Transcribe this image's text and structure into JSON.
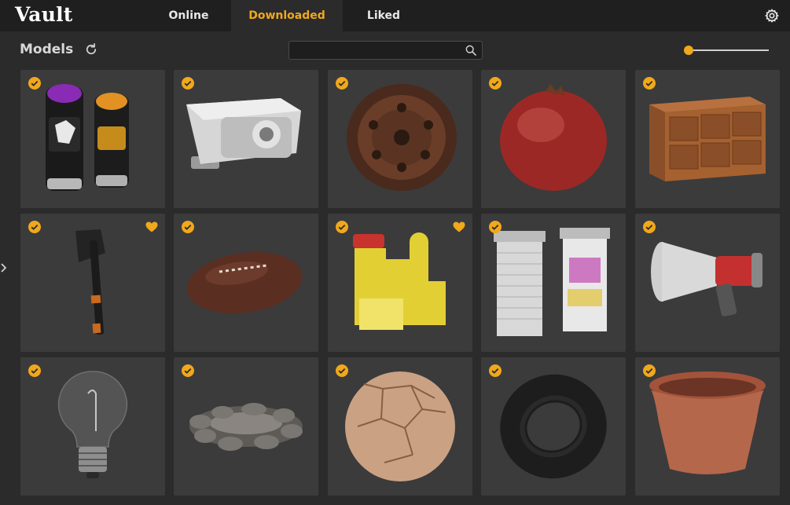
{
  "app": {
    "title": "Vault"
  },
  "tabs": [
    {
      "label": "Online",
      "active": false
    },
    {
      "label": "Downloaded",
      "active": true
    },
    {
      "label": "Liked",
      "active": false
    }
  ],
  "toolbar": {
    "section_title": "Models",
    "search_value": "",
    "search_placeholder": "",
    "size_slider_level": 0.0
  },
  "colors": {
    "accent": "#f0a81c",
    "background": "#2b2b2b",
    "topbar": "#1f1f1f",
    "card": "#3b3b3b"
  },
  "icons": {
    "settings": "gear-icon",
    "refresh": "refresh-icon",
    "search": "search-icon",
    "downloaded_badge": "check-circle-icon",
    "liked_badge": "heart-icon",
    "collapse": "chevron-right-icon"
  },
  "models": [
    {
      "subject": "spray-cans",
      "downloaded": true,
      "liked": false
    },
    {
      "subject": "security-camera",
      "downloaded": true,
      "liked": false
    },
    {
      "subject": "steel-wheel-rim",
      "downloaded": true,
      "liked": false
    },
    {
      "subject": "pomegranate",
      "downloaded": true,
      "liked": false
    },
    {
      "subject": "wooden-drawer-cabinet",
      "downloaded": true,
      "liked": false
    },
    {
      "subject": "axe",
      "downloaded": true,
      "liked": true
    },
    {
      "subject": "rugby-ball",
      "downloaded": true,
      "liked": false
    },
    {
      "subject": "drain-unblocker-bottle",
      "downloaded": true,
      "liked": true
    },
    {
      "subject": "roller-shutters",
      "downloaded": true,
      "liked": false
    },
    {
      "subject": "megaphone",
      "downloaded": true,
      "liked": false
    },
    {
      "subject": "light-bulb",
      "downloaded": true,
      "liked": false
    },
    {
      "subject": "stone-fire-pit",
      "downloaded": true,
      "liked": false
    },
    {
      "subject": "leather-football",
      "downloaded": true,
      "liked": false
    },
    {
      "subject": "tire",
      "downloaded": true,
      "liked": false
    },
    {
      "subject": "terracotta-pot",
      "downloaded": true,
      "liked": false
    }
  ]
}
